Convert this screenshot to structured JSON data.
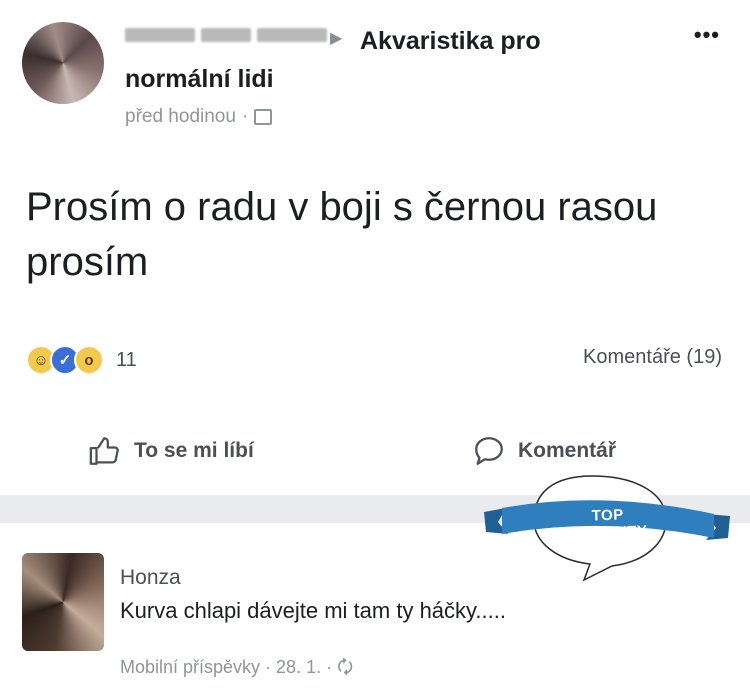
{
  "post": {
    "author_blurred": true,
    "group_name": "Akvaristika pro normální lidi",
    "time": "před hodinou",
    "more_label": "•••",
    "text": "Prosím o radu v boji s černou rasou prosím",
    "reaction_count": "11",
    "comments_count": "Komentáře (19)",
    "like_label": "To se mi líbí",
    "comment_label": "Komentář"
  },
  "badge": {
    "label": "TOP KOMENTY",
    "ribbon_color": "#2f7fbf"
  },
  "comment": {
    "author": "Honza",
    "text": "Kurva chlapi dávejte mi tam ty háčky.....",
    "meta": "Mobilní příspěvky · 28. 1. ·"
  },
  "colors": {
    "background": "#ffffff",
    "divider": "#e9ebee",
    "secondary_text": "#90949c"
  }
}
